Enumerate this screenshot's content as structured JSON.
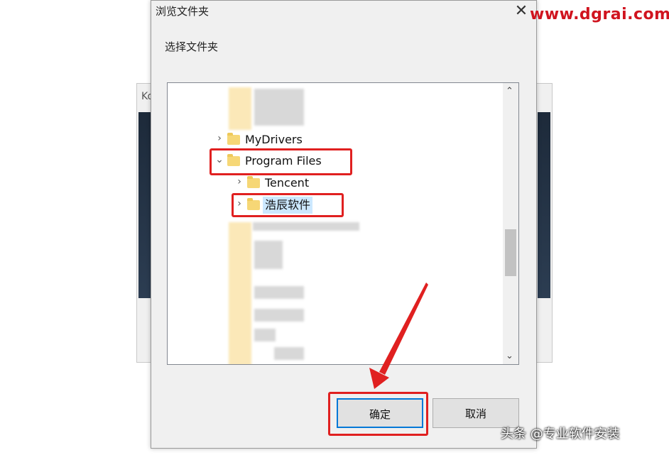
{
  "background_window": {
    "title_fragment": "Ko"
  },
  "dialog": {
    "title": "浏览文件夹",
    "close_glyph": "✕",
    "description": "选择文件夹"
  },
  "tree": {
    "rows": [
      {
        "label": "MyDrivers",
        "chevron": "›"
      },
      {
        "label": "Program Files",
        "chevron": "⌄"
      },
      {
        "label": "Tencent",
        "chevron": "›"
      },
      {
        "label": "浩辰软件",
        "chevron": "›",
        "selected": true
      }
    ],
    "scroll_up": "⌃",
    "scroll_down": "⌄"
  },
  "buttons": {
    "ok": "确定",
    "cancel": "取消"
  },
  "watermark": "www.dgrai.com",
  "footer": "头条 @专业软件安装",
  "colors": {
    "highlight": "#e02020",
    "selection": "#cce8ff",
    "folder": "#f6d776",
    "watermark": "#d0141f"
  }
}
